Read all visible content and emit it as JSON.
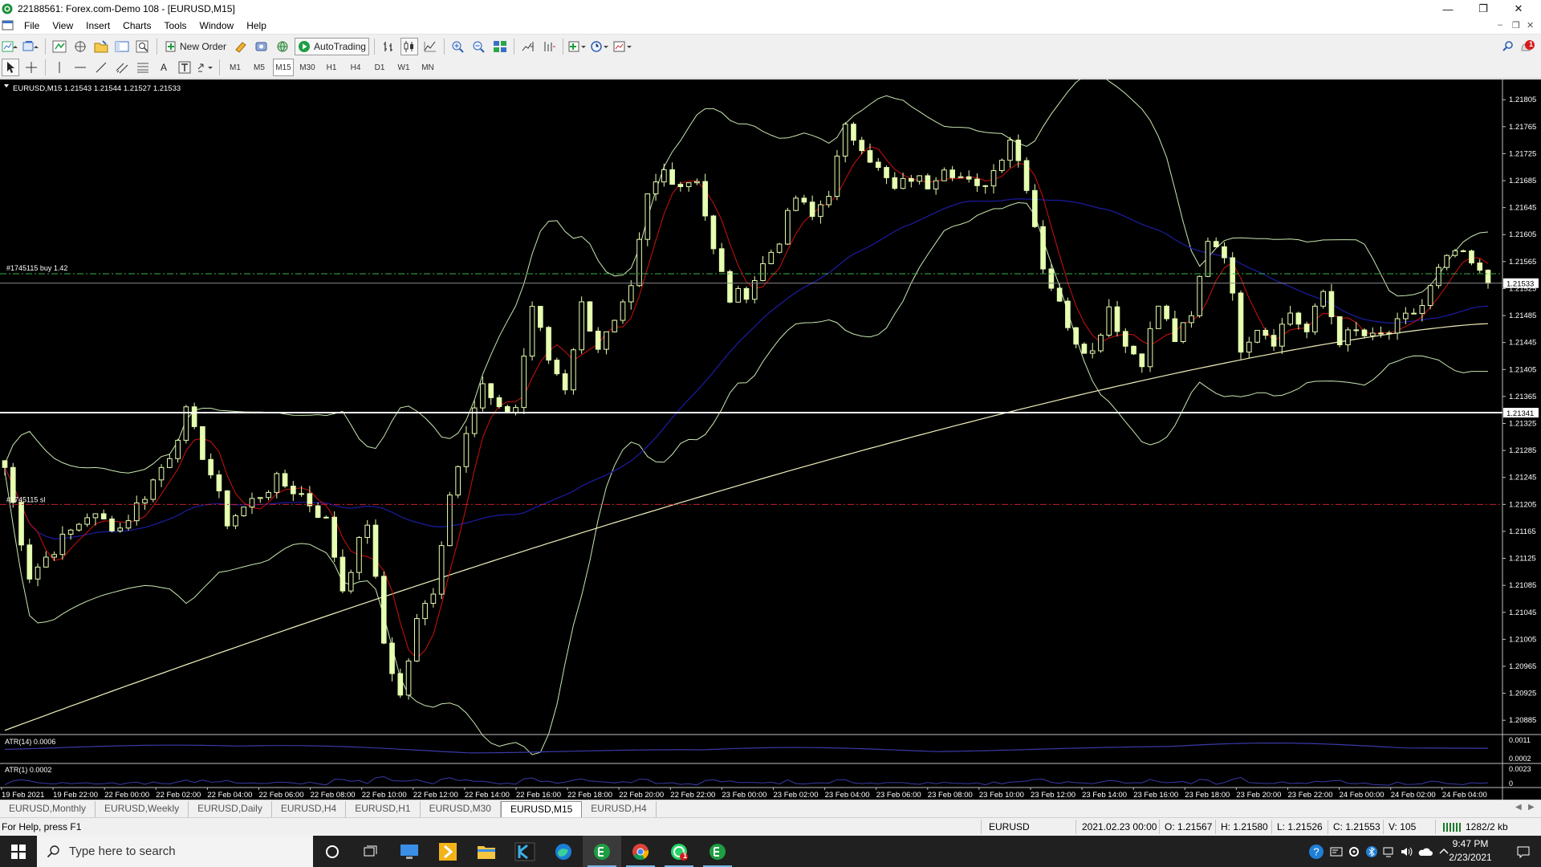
{
  "window": {
    "title": "22188561: Forex.com-Demo 108 - [EURUSD,M15]"
  },
  "menu": [
    "File",
    "View",
    "Insert",
    "Charts",
    "Tools",
    "Window",
    "Help"
  ],
  "toolbar": {
    "new_order": "New Order",
    "auto_trading": "AutoTrading",
    "notification_count": "1"
  },
  "timeframes": [
    "M1",
    "M5",
    "M15",
    "M30",
    "H1",
    "H4",
    "D1",
    "W1",
    "MN"
  ],
  "active_timeframe": "M15",
  "chart": {
    "header": "EURUSD,M15  1.21543 1.21544 1.21527 1.21533",
    "symbol": "EURUSD",
    "timeframe": "M15",
    "ohlc": {
      "open": 1.21543,
      "high": 1.21544,
      "low": 1.21527,
      "close": 1.21533
    },
    "trade_label": "#1745115 buy 1.42",
    "sl_label": "#1745115 sl",
    "trade_price": 1.21547,
    "sl_price": 1.21205,
    "current_price_label": "1.21533",
    "hline_label": "1.21341",
    "hline_price": 1.21341,
    "atr14_label": "ATR(14) 0.0006",
    "atr1_label": "ATR(1) 0.0002",
    "price_scale": [
      "1.21805",
      "1.21765",
      "1.21725",
      "1.21685",
      "1.21645",
      "1.21605",
      "1.21565",
      "1.21525",
      "1.21485",
      "1.21445",
      "1.21405",
      "1.21365",
      "1.21325",
      "1.21285",
      "1.21245",
      "1.21205",
      "1.21165",
      "1.21125",
      "1.21085",
      "1.21045",
      "1.21005",
      "1.20965",
      "1.20925",
      "1.20885"
    ],
    "atr14_scale": [
      "0.0011",
      "0.0002"
    ],
    "atr1_scale": [
      "0.0023",
      "0"
    ],
    "time_labels": [
      "19 Feb 2021",
      "19 Feb 22:00",
      "22 Feb 00:00",
      "22 Feb 02:00",
      "22 Feb 04:00",
      "22 Feb 06:00",
      "22 Feb 08:00",
      "22 Feb 10:00",
      "22 Feb 12:00",
      "22 Feb 14:00",
      "22 Feb 16:00",
      "22 Feb 18:00",
      "22 Feb 20:00",
      "22 Feb 22:00",
      "23 Feb 00:00",
      "23 Feb 02:00",
      "23 Feb 04:00",
      "23 Feb 06:00",
      "23 Feb 08:00",
      "23 Feb 10:00",
      "23 Feb 12:00",
      "23 Feb 14:00",
      "23 Feb 16:00",
      "23 Feb 18:00",
      "23 Feb 20:00",
      "23 Feb 22:00",
      "24 Feb 00:00",
      "24 Feb 02:00",
      "24 Feb 04:00"
    ],
    "colors": {
      "background": "#000000",
      "bull_candle": "#e6ffb0",
      "bear_candle": "#000000",
      "fast_ma": "#d01010",
      "mid_ma": "#1a1a9a",
      "slow_ma": "#f2f0bc",
      "bands": "#c8e8b0",
      "trade_line": "#3cb044",
      "sl_line": "#c8202a",
      "atr": "#3a3aa8"
    }
  },
  "chart_data": {
    "type": "candlestick",
    "symbol": "EURUSD",
    "timeframe": "M15",
    "ylim": [
      1.20865,
      1.21835
    ],
    "series_path": [
      {
        "x": 0,
        "price": 1.2126
      },
      {
        "x": 3,
        "price": 1.211
      },
      {
        "x": 6,
        "price": 1.2114
      },
      {
        "x": 10,
        "price": 1.2119
      },
      {
        "x": 14,
        "price": 1.2117
      },
      {
        "x": 17,
        "price": 1.2122
      },
      {
        "x": 20,
        "price": 1.2128
      },
      {
        "x": 22,
        "price": 1.2134
      },
      {
        "x": 25,
        "price": 1.2125
      },
      {
        "x": 27,
        "price": 1.2118
      },
      {
        "x": 30,
        "price": 1.2121
      },
      {
        "x": 33,
        "price": 1.2124
      },
      {
        "x": 36,
        "price": 1.2122
      },
      {
        "x": 39,
        "price": 1.2118
      },
      {
        "x": 41,
        "price": 1.2108
      },
      {
        "x": 44,
        "price": 1.2118
      },
      {
        "x": 46,
        "price": 1.21
      },
      {
        "x": 48,
        "price": 1.2092
      },
      {
        "x": 50,
        "price": 1.2103
      },
      {
        "x": 52,
        "price": 1.2108
      },
      {
        "x": 54,
        "price": 1.2122
      },
      {
        "x": 56,
        "price": 1.2132
      },
      {
        "x": 58,
        "price": 1.2138
      },
      {
        "x": 60,
        "price": 1.2134
      },
      {
        "x": 62,
        "price": 1.2135
      },
      {
        "x": 64,
        "price": 1.215
      },
      {
        "x": 66,
        "price": 1.2142
      },
      {
        "x": 68,
        "price": 1.2138
      },
      {
        "x": 70,
        "price": 1.215
      },
      {
        "x": 72,
        "price": 1.2144
      },
      {
        "x": 74,
        "price": 1.2147
      },
      {
        "x": 76,
        "price": 1.2152
      },
      {
        "x": 78,
        "price": 1.2166
      },
      {
        "x": 80,
        "price": 1.217
      },
      {
        "x": 82,
        "price": 1.2168
      },
      {
        "x": 84,
        "price": 1.2169
      },
      {
        "x": 86,
        "price": 1.2158
      },
      {
        "x": 88,
        "price": 1.2151
      },
      {
        "x": 90,
        "price": 1.2152
      },
      {
        "x": 92,
        "price": 1.2156
      },
      {
        "x": 94,
        "price": 1.216
      },
      {
        "x": 96,
        "price": 1.2166
      },
      {
        "x": 98,
        "price": 1.2163
      },
      {
        "x": 100,
        "price": 1.2167
      },
      {
        "x": 102,
        "price": 1.2176
      },
      {
        "x": 104,
        "price": 1.2174
      },
      {
        "x": 106,
        "price": 1.217
      },
      {
        "x": 108,
        "price": 1.2167
      },
      {
        "x": 110,
        "price": 1.2169
      },
      {
        "x": 112,
        "price": 1.2168
      },
      {
        "x": 114,
        "price": 1.2171
      },
      {
        "x": 116,
        "price": 1.2169
      },
      {
        "x": 118,
        "price": 1.2167
      },
      {
        "x": 120,
        "price": 1.217
      },
      {
        "x": 122,
        "price": 1.2175
      },
      {
        "x": 124,
        "price": 1.2168
      },
      {
        "x": 126,
        "price": 1.2156
      },
      {
        "x": 128,
        "price": 1.215
      },
      {
        "x": 130,
        "price": 1.2145
      },
      {
        "x": 132,
        "price": 1.2143
      },
      {
        "x": 134,
        "price": 1.215
      },
      {
        "x": 136,
        "price": 1.2144
      },
      {
        "x": 138,
        "price": 1.2142
      },
      {
        "x": 140,
        "price": 1.215
      },
      {
        "x": 142,
        "price": 1.2145
      },
      {
        "x": 144,
        "price": 1.2148
      },
      {
        "x": 146,
        "price": 1.216
      },
      {
        "x": 148,
        "price": 1.2158
      },
      {
        "x": 150,
        "price": 1.2144
      },
      {
        "x": 152,
        "price": 1.2147
      },
      {
        "x": 154,
        "price": 1.2145
      },
      {
        "x": 156,
        "price": 1.2149
      },
      {
        "x": 158,
        "price": 1.2146
      },
      {
        "x": 160,
        "price": 1.2152
      },
      {
        "x": 162,
        "price": 1.2145
      },
      {
        "x": 164,
        "price": 1.2146
      },
      {
        "x": 166,
        "price": 1.2145
      },
      {
        "x": 168,
        "price": 1.2146
      },
      {
        "x": 170,
        "price": 1.2148
      },
      {
        "x": 172,
        "price": 1.215
      },
      {
        "x": 174,
        "price": 1.2155
      },
      {
        "x": 176,
        "price": 1.2158
      },
      {
        "x": 178,
        "price": 1.2156
      },
      {
        "x": 180,
        "price": 1.2153
      }
    ],
    "price_levels": [
      {
        "name": "#1745115 buy 1.42",
        "price": 1.21547
      },
      {
        "name": "#1745115 sl",
        "price": 1.21205
      },
      {
        "name": "horizontal line",
        "price": 1.21341
      },
      {
        "name": "bid",
        "price": 1.21533
      }
    ]
  },
  "tabs": [
    "EURUSD,Monthly",
    "EURUSD,Weekly",
    "EURUSD,Daily",
    "EURUSD,H4",
    "EURUSD,H1",
    "EURUSD,M30",
    "EURUSD,M15",
    "EURUSD,H4"
  ],
  "active_tab": 6,
  "status": {
    "help": "For Help, press F1",
    "symbol": "EURUSD",
    "datetime": "2021.02.23 00:00",
    "open": "O: 1.21567",
    "high": "H: 1.21580",
    "low": "L: 1.21526",
    "close": "C: 1.21553",
    "volume": "V: 105",
    "traffic": "1282/2 kb"
  },
  "taskbar": {
    "search_placeholder": "Type here to search",
    "time": "9:47 PM",
    "date": "2/23/2021",
    "whatsapp_badge": "1"
  }
}
